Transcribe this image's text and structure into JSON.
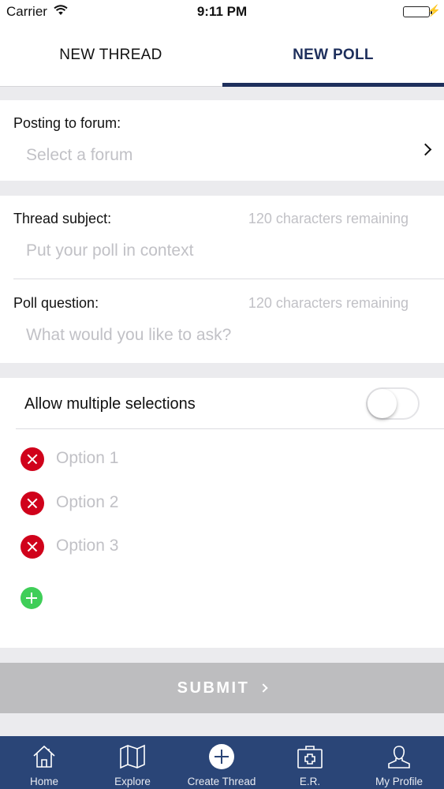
{
  "status_bar": {
    "carrier": "Carrier",
    "time": "9:11 PM"
  },
  "tabs": [
    {
      "label": "NEW THREAD",
      "selected": false
    },
    {
      "label": "NEW POLL",
      "selected": true
    }
  ],
  "forum": {
    "label": "Posting to forum:",
    "placeholder": "Select a forum"
  },
  "thread_subject": {
    "label": "Thread subject:",
    "remaining": "120 characters remaining",
    "placeholder": "Put your poll in context"
  },
  "poll_question": {
    "label": "Poll question:",
    "remaining": "120 characters remaining",
    "placeholder": "What would you like to ask?"
  },
  "multiple_selections": {
    "label": "Allow multiple selections",
    "enabled": false
  },
  "options": [
    {
      "placeholder": "Option 1"
    },
    {
      "placeholder": "Option 2"
    },
    {
      "placeholder": "Option 3"
    }
  ],
  "submit": {
    "label": "SUBMIT"
  },
  "tabbar": [
    {
      "label": "Home",
      "icon": "home-icon"
    },
    {
      "label": "Explore",
      "icon": "map-icon"
    },
    {
      "label": "Create Thread",
      "icon": "plus-circle-icon"
    },
    {
      "label": "E.R.",
      "icon": "medical-kit-icon"
    },
    {
      "label": "My Profile",
      "icon": "person-icon"
    }
  ],
  "colors": {
    "accent_navy": "#1e2f5c",
    "tabbar_bg": "#2a4577",
    "remove_red": "#d0021b",
    "add_green": "#3fce58",
    "submit_disabled": "#bdbdbf",
    "battery_green": "#37c94a"
  }
}
